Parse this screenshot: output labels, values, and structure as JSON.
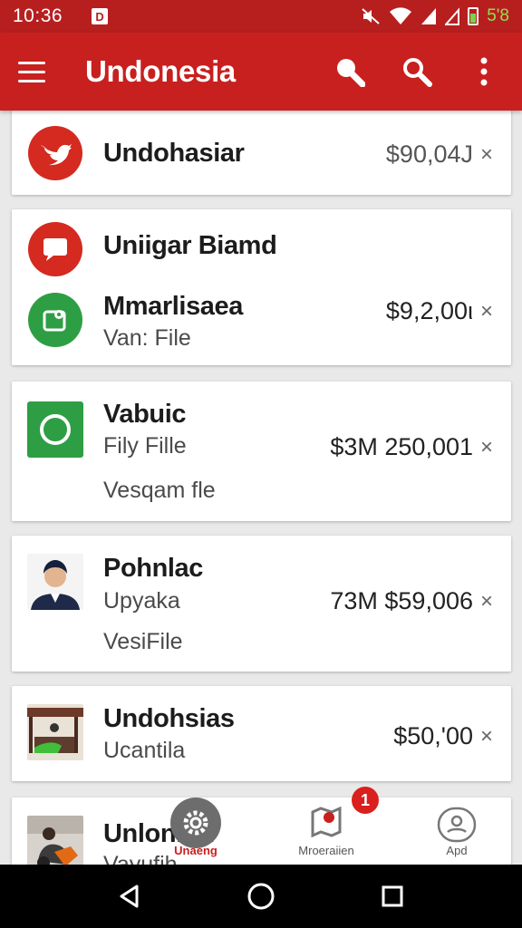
{
  "status_bar": {
    "time": "10:36",
    "app_badge": "D",
    "battery_text": "5'8"
  },
  "app_bar": {
    "title": "Undonesia"
  },
  "items": [
    {
      "title": "Undohasiar",
      "subtitle": "",
      "subtitle2": "",
      "price": "$90,04J"
    },
    {
      "title": "Uniigar Biamd",
      "title2": "Mmarlisaea",
      "subtitle": "Van: File",
      "price": "$9,2,00ι"
    },
    {
      "title": "Vabuic",
      "subtitle": "Fily Fille",
      "subtitle2": "Vesqam fle",
      "price": "$3M 250,001"
    },
    {
      "title": "Pohnlac",
      "subtitle": "Upyaka",
      "subtitle2": "VesiFile",
      "price": "73M $59,006"
    },
    {
      "title": "Undohsias",
      "subtitle": "Ucantila",
      "price": "$50,'00"
    },
    {
      "title": "Unlonnia",
      "subtitle": "Vayufih"
    }
  ],
  "close_glyph": "×",
  "bottom_nav": [
    {
      "label": "Unaeng",
      "active": true
    },
    {
      "label": "Mroeraiien",
      "badge": "1"
    },
    {
      "label": "Apd"
    }
  ],
  "colors": {
    "primary": "#c8201f",
    "status": "#b71f1f",
    "twitter_red": "#d42a20",
    "green": "#2e9e44"
  },
  "icons": [
    "menu-icon",
    "search-icon",
    "search-icon",
    "more-vert-icon",
    "bird-icon",
    "chat-icon",
    "photo-icon",
    "circle-icon",
    "settings-icon",
    "map-icon",
    "profile-icon",
    "back-icon",
    "home-icon",
    "recents-icon"
  ]
}
